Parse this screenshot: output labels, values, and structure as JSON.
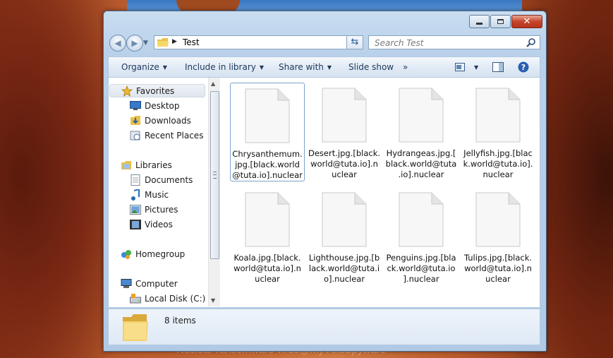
{
  "watermark": "Nuclear ransomware virus@My AntiSpyware",
  "address": {
    "path": "Test"
  },
  "search": {
    "placeholder": "Search Test"
  },
  "toolbar": {
    "organize": "Organize",
    "include_in_library": "Include in library",
    "share_with": "Share with",
    "slide_show": "Slide show",
    "more": "»"
  },
  "sidebar": {
    "items": [
      {
        "label": "Favorites",
        "icon": "star-icon"
      },
      {
        "label": "Desktop",
        "icon": "desktop-icon"
      },
      {
        "label": "Downloads",
        "icon": "downloads-icon"
      },
      {
        "label": "Recent Places",
        "icon": "recent-places-icon"
      },
      {
        "label": "Libraries",
        "icon": "libraries-icon"
      },
      {
        "label": "Documents",
        "icon": "documents-icon"
      },
      {
        "label": "Music",
        "icon": "music-icon"
      },
      {
        "label": "Pictures",
        "icon": "pictures-icon"
      },
      {
        "label": "Videos",
        "icon": "videos-icon"
      },
      {
        "label": "Homegroup",
        "icon": "homegroup-icon"
      },
      {
        "label": "Computer",
        "icon": "computer-icon"
      },
      {
        "label": "Local Disk (C:)",
        "icon": "local-disk-icon"
      }
    ]
  },
  "files": [
    {
      "name": "Chrysanthemum.jpg.[black.world@tuta.io].nuclear",
      "lines": [
        "Chrysanthemum.",
        "jpg.[black.world",
        "@tuta.io].nuclear"
      ]
    },
    {
      "name": "Desert.jpg.[black.world@tuta.io].nuclear",
      "lines": [
        "Desert.jpg.[black.",
        "world@tuta.io].n",
        "uclear"
      ]
    },
    {
      "name": "Hydrangeas.jpg.[black.world@tuta.io].nuclear",
      "lines": [
        "Hydrangeas.jpg.[",
        "black.world@tuta",
        ".io].nuclear"
      ]
    },
    {
      "name": "Jellyfish.jpg.[black.world@tuta.io].nuclear",
      "lines": [
        "Jellyfish.jpg.[blac",
        "k.world@tuta.io].",
        "nuclear"
      ]
    },
    {
      "name": "Koala.jpg.[black.world@tuta.io].nuclear",
      "lines": [
        "Koala.jpg.[black.",
        "world@tuta.io].n",
        "uclear"
      ]
    },
    {
      "name": "Lighthouse.jpg.[black.world@tuta.io].nuclear",
      "lines": [
        "Lighthouse.jpg.[b",
        "lack.world@tuta.i",
        "o].nuclear"
      ]
    },
    {
      "name": "Penguins.jpg.[black.world@tuta.io].nuclear",
      "lines": [
        "Penguins.jpg.[bla",
        "ck.world@tuta.io",
        "].nuclear"
      ]
    },
    {
      "name": "Tulips.jpg.[black.world@tuta.io].nuclear",
      "lines": [
        "Tulips.jpg.[black.",
        "world@tuta.io].n",
        "uclear"
      ]
    }
  ],
  "status": {
    "item_count": "8 items"
  },
  "colors": {
    "toolbar_text": "#1e395b",
    "close_button": "#c4452c",
    "window_frame": "#b9d1ea"
  }
}
